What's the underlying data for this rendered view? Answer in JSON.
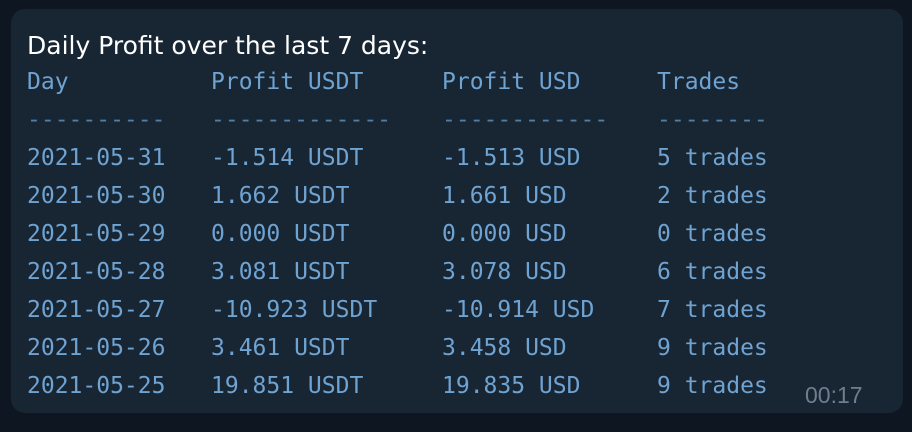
{
  "message": {
    "title": "Daily Profit over the last 7 days:",
    "headers": [
      "Day",
      "Profit USDT",
      "Profit USD",
      "Trades"
    ],
    "dividers": [
      "----------",
      "-------------",
      "------------",
      "--------"
    ],
    "rows": [
      [
        "2021-05-31",
        "-1.514 USDT",
        "-1.513 USD",
        "5 trades"
      ],
      [
        "2021-05-30",
        "1.662 USDT",
        "1.661 USD",
        "2 trades"
      ],
      [
        "2021-05-29",
        "0.000 USDT",
        "0.000 USD",
        "0 trades"
      ],
      [
        "2021-05-28",
        "3.081 USDT",
        "3.078 USD",
        "6 trades"
      ],
      [
        "2021-05-27",
        "-10.923 USDT",
        "-10.914 USD",
        "7 trades"
      ],
      [
        "2021-05-26",
        "3.461 USDT",
        "3.458 USD",
        "9 trades"
      ],
      [
        "2021-05-25",
        "19.851 USDT",
        "19.835 USD",
        "9 trades"
      ]
    ],
    "time": "00:17"
  }
}
